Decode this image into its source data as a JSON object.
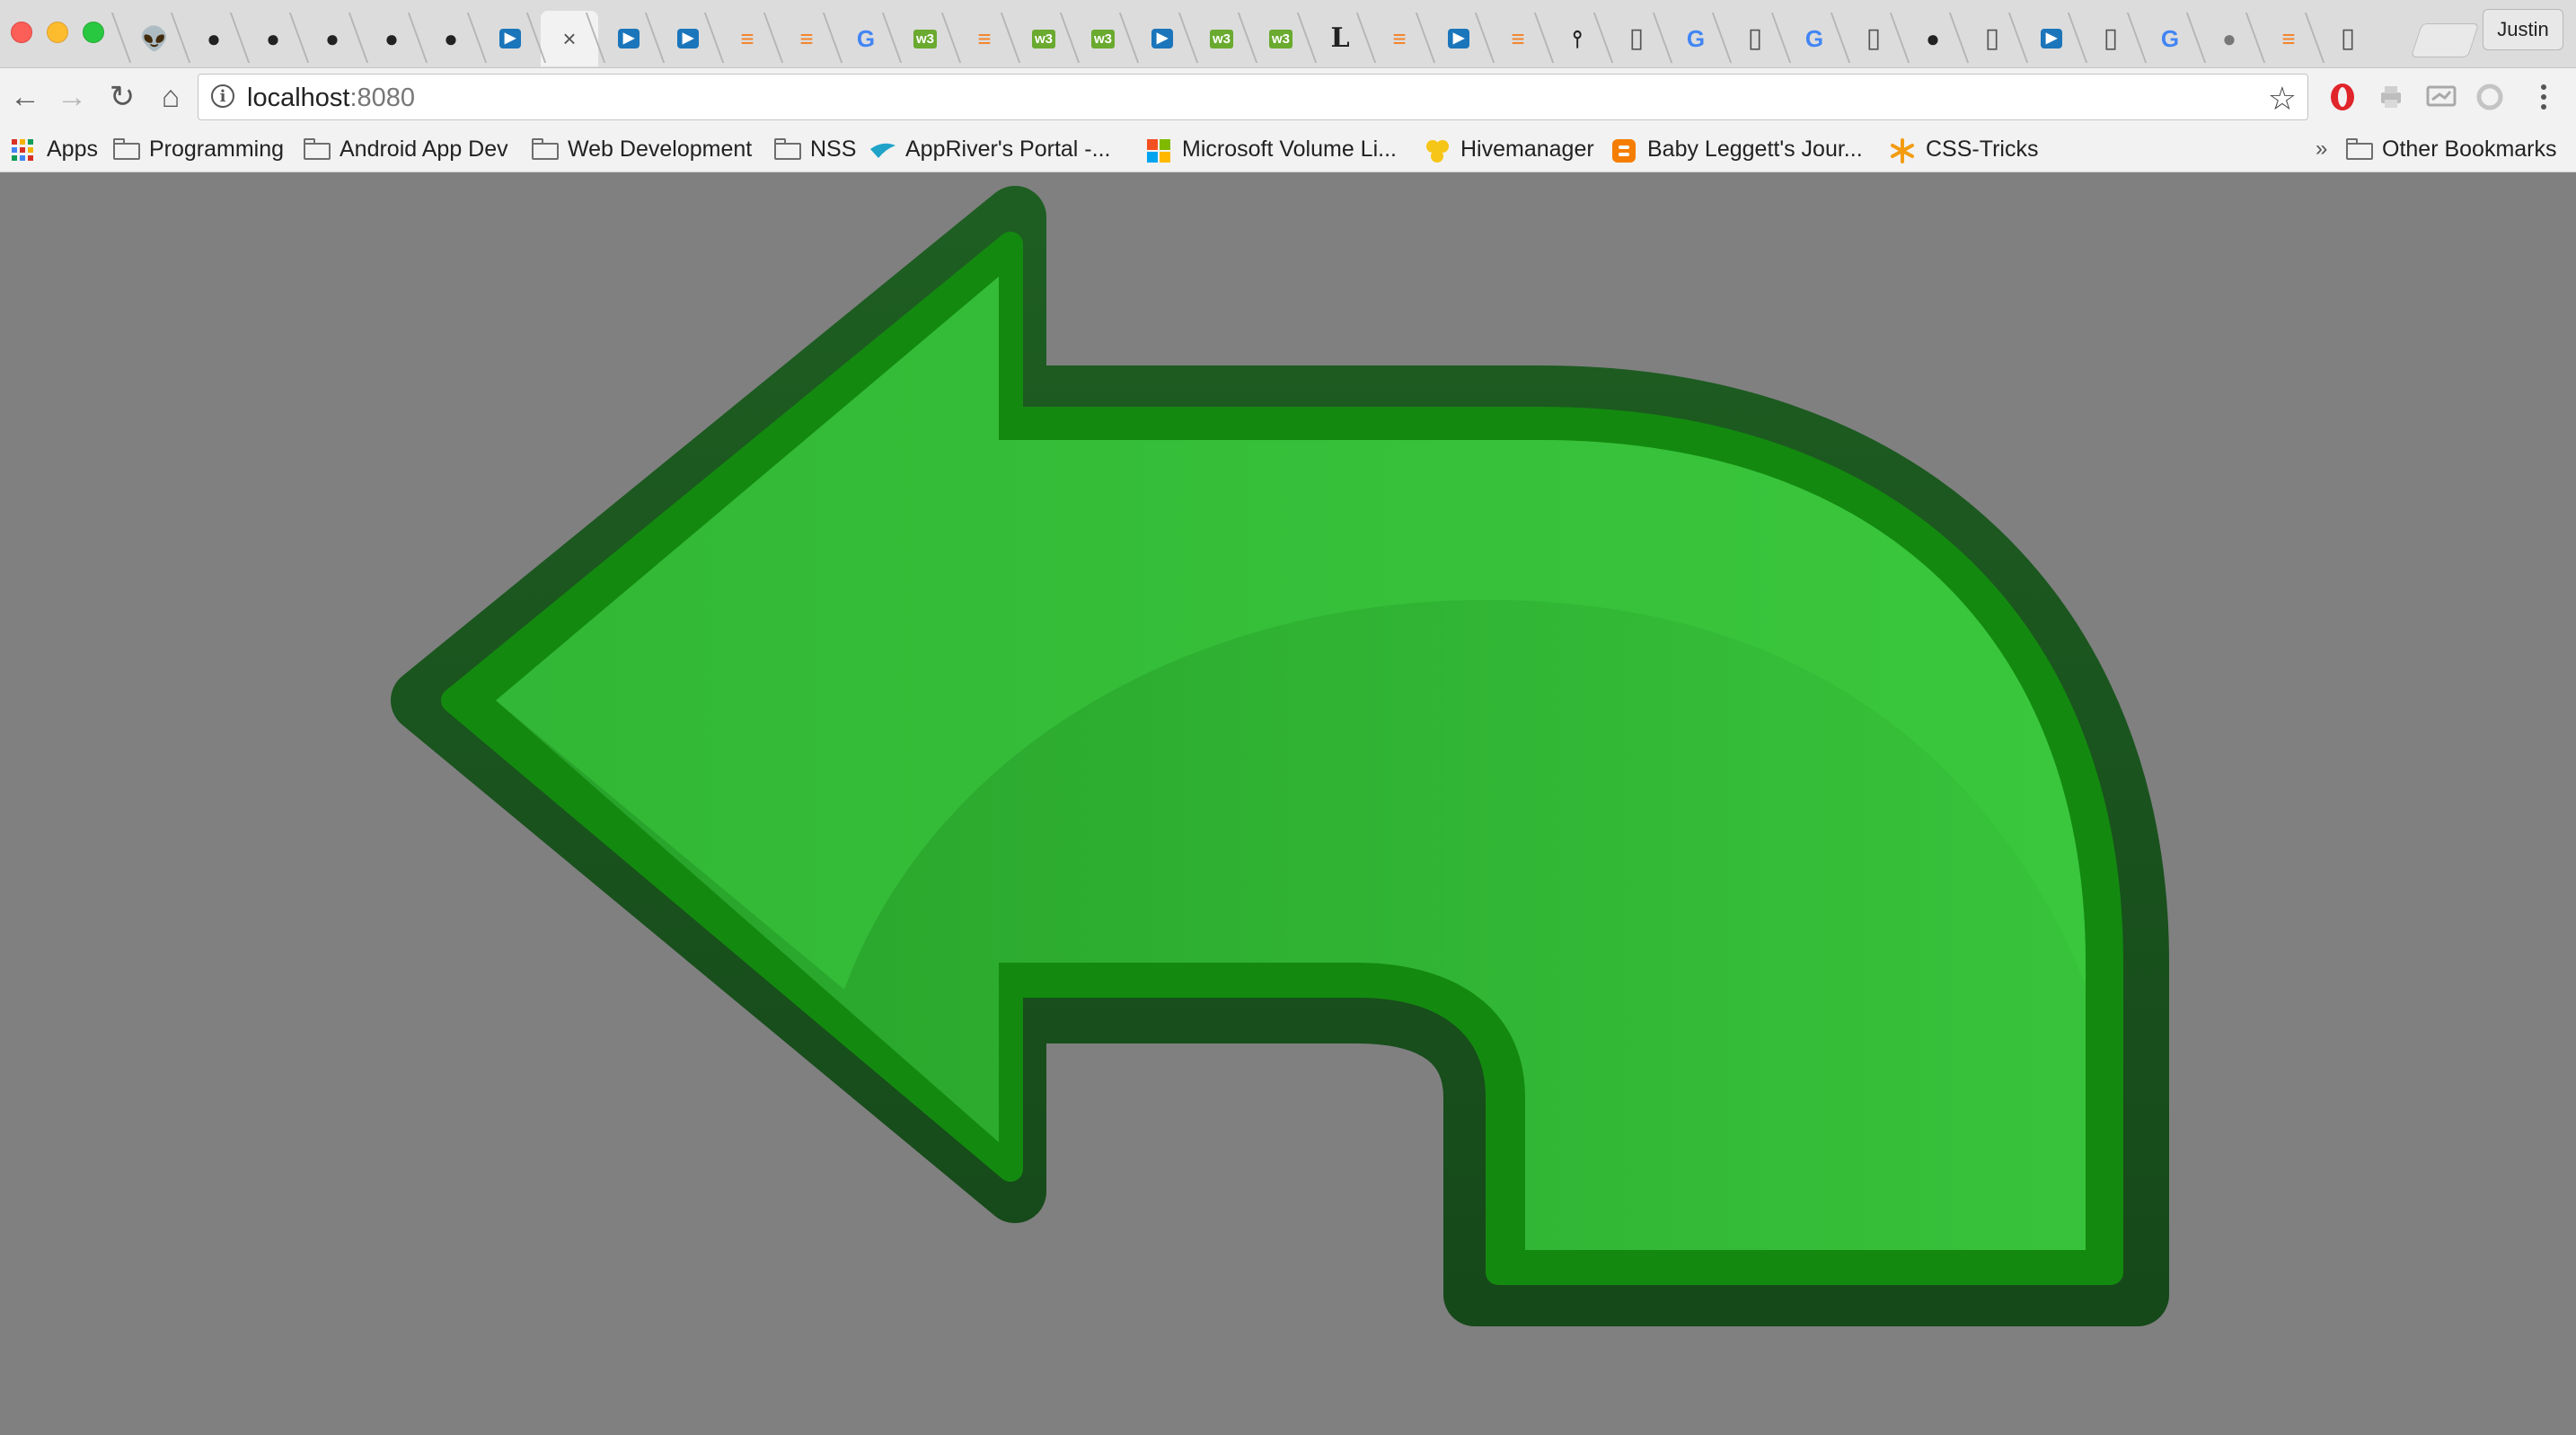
{
  "window": {
    "profile_name": "Justin",
    "controls": [
      "close",
      "minimize",
      "zoom"
    ]
  },
  "tabs": [
    {
      "icon": "reddit-icon",
      "glyph": "👽"
    },
    {
      "icon": "github-icon",
      "glyph": "●"
    },
    {
      "icon": "github-icon",
      "glyph": "●"
    },
    {
      "icon": "github-icon",
      "glyph": "●"
    },
    {
      "icon": "github-icon",
      "glyph": "●"
    },
    {
      "icon": "github-icon",
      "glyph": "●"
    },
    {
      "icon": "slides-icon",
      "glyph": "▶"
    },
    {
      "icon": "close-icon",
      "glyph": "×",
      "active": true
    },
    {
      "icon": "slides-icon",
      "glyph": "▶"
    },
    {
      "icon": "slides-icon",
      "glyph": "▶"
    },
    {
      "icon": "stackoverflow-icon",
      "glyph": "≡"
    },
    {
      "icon": "stackoverflow-icon",
      "glyph": "≡"
    },
    {
      "icon": "google-icon",
      "glyph": "G"
    },
    {
      "icon": "w3-icon",
      "glyph": "w3"
    },
    {
      "icon": "stackoverflow-icon",
      "glyph": "≡"
    },
    {
      "icon": "w3-icon",
      "glyph": "w3"
    },
    {
      "icon": "w3-icon",
      "glyph": "w3"
    },
    {
      "icon": "slides-icon",
      "glyph": "▶"
    },
    {
      "icon": "w3-icon",
      "glyph": "w3"
    },
    {
      "icon": "w3-icon",
      "glyph": "w3"
    },
    {
      "icon": "letter-l-icon",
      "glyph": "L"
    },
    {
      "icon": "stackoverflow-icon",
      "glyph": "≡"
    },
    {
      "icon": "slides-icon",
      "glyph": "▶"
    },
    {
      "icon": "stackoverflow-icon",
      "glyph": "≡"
    },
    {
      "icon": "pin-icon",
      "glyph": "⫯"
    },
    {
      "icon": "document-icon",
      "glyph": "▯"
    },
    {
      "icon": "google-icon",
      "glyph": "G"
    },
    {
      "icon": "document-icon",
      "glyph": "▯"
    },
    {
      "icon": "google-icon",
      "glyph": "G"
    },
    {
      "icon": "document-icon",
      "glyph": "▯"
    },
    {
      "icon": "github-icon",
      "glyph": "●"
    },
    {
      "icon": "document-icon",
      "glyph": "▯"
    },
    {
      "icon": "slides-icon",
      "glyph": "▶"
    },
    {
      "icon": "document-icon",
      "glyph": "▯"
    },
    {
      "icon": "google-icon",
      "glyph": "G"
    },
    {
      "icon": "apple-icon",
      "glyph": "●"
    },
    {
      "icon": "stackoverflow-icon",
      "glyph": "≡"
    },
    {
      "icon": "document-icon",
      "glyph": "▯"
    }
  ],
  "nav": {
    "back": "←",
    "forward": "→",
    "reload": "↻",
    "home": "⌂"
  },
  "omnibox": {
    "host": "localhost",
    "port": ":8080",
    "star": "☆"
  },
  "bookmarks": {
    "apps": "Apps",
    "items": [
      {
        "label": "Programming",
        "icon": "folder-icon"
      },
      {
        "label": "Android App Dev",
        "icon": "folder-icon"
      },
      {
        "label": "Web Development",
        "icon": "folder-icon"
      },
      {
        "label": "NSS",
        "icon": "folder-icon"
      },
      {
        "label": "AppRiver's Portal -...",
        "icon": "appriver-icon"
      },
      {
        "label": "Microsoft Volume Li...",
        "icon": "microsoft-icon"
      },
      {
        "label": "Hivemanager",
        "icon": "hive-icon"
      },
      {
        "label": "Baby Leggett's Jour...",
        "icon": "blogger-icon"
      },
      {
        "label": "CSS-Tricks",
        "icon": "css-tricks-icon"
      }
    ],
    "overflow": "»",
    "other": "Other Bookmarks"
  },
  "colors": {
    "page_background": "#808080",
    "arrow_outline": "#19521f",
    "arrow_inner_outline": "#138a0f",
    "arrow_fill": "#2fb42f",
    "arrow_highlight": "#3ccb3f"
  }
}
